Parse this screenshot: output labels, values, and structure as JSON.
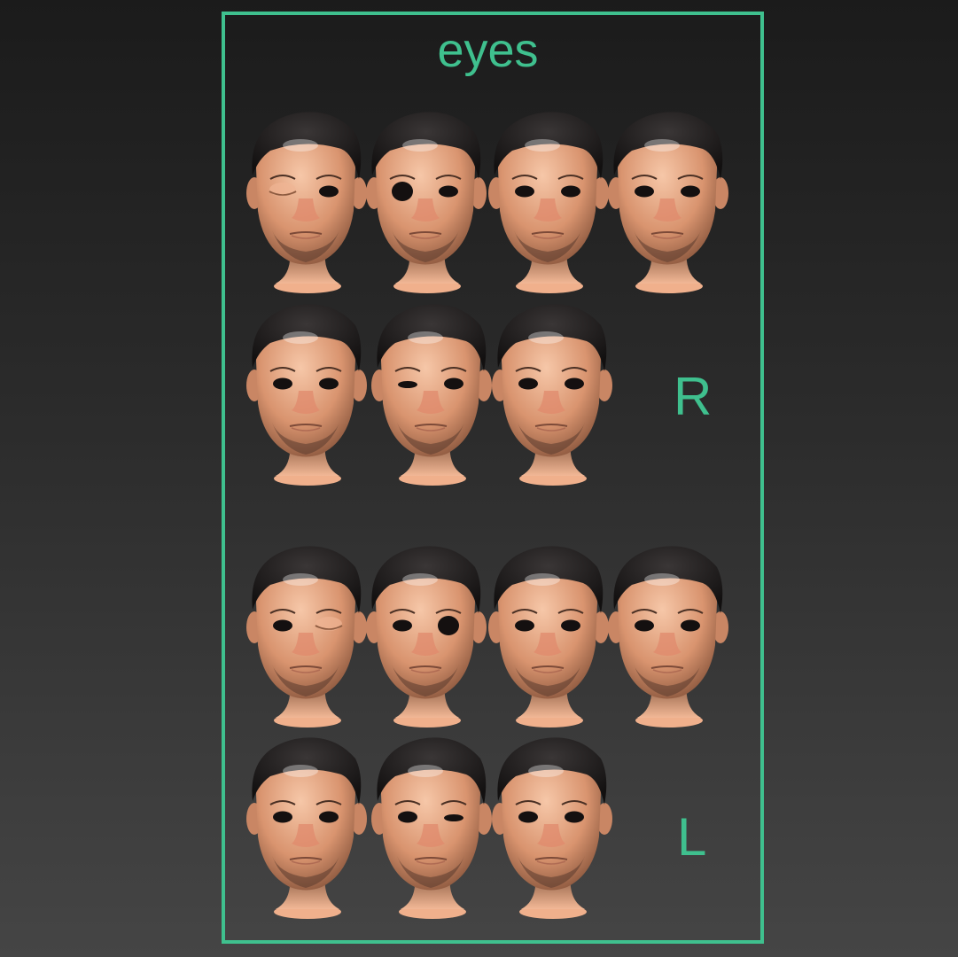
{
  "panel": {
    "title": "eyes",
    "accent_color": "#3fc08e",
    "groups": [
      {
        "label": "R",
        "heads": [
          {
            "left": "open",
            "right": "closed"
          },
          {
            "left": "open",
            "right": "wide"
          },
          {
            "left": "open",
            "right": "open"
          },
          {
            "left": "open",
            "right": "open"
          },
          {
            "left": "open",
            "right": "open"
          },
          {
            "left": "open",
            "right": "squint"
          },
          {
            "left": "open",
            "right": "open"
          }
        ]
      },
      {
        "label": "L",
        "heads": [
          {
            "left": "closed",
            "right": "open"
          },
          {
            "left": "wide",
            "right": "open"
          },
          {
            "left": "open",
            "right": "open"
          },
          {
            "left": "open",
            "right": "open"
          },
          {
            "left": "open",
            "right": "open"
          },
          {
            "left": "squint",
            "right": "open"
          },
          {
            "left": "open",
            "right": "open"
          }
        ]
      }
    ]
  }
}
